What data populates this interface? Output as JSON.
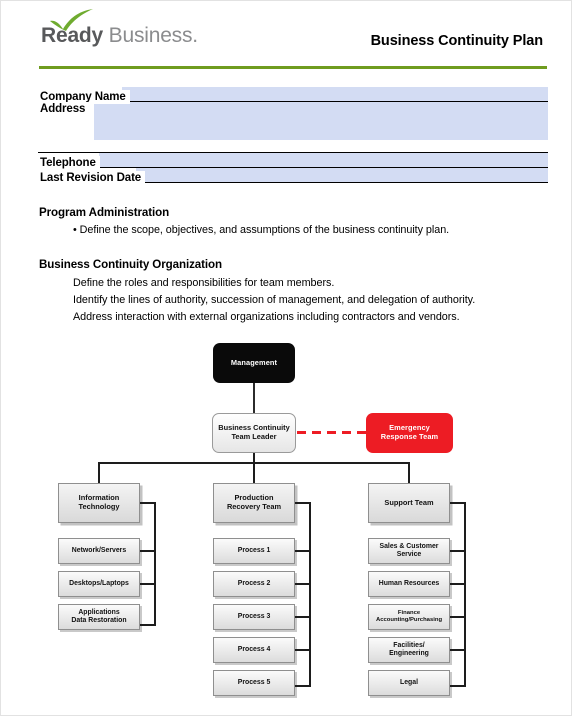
{
  "header": {
    "logo_ready": "Ready",
    "logo_business": " Business.",
    "check_icon": "green-check-icon",
    "doc_title": "Business Continuity Plan",
    "rule_color": "#6f9c1f"
  },
  "form": {
    "fields": [
      {
        "label": "Company Name",
        "value": "",
        "placeholder": ""
      },
      {
        "label": "Address",
        "value": "",
        "placeholder": ""
      },
      {
        "label": "Telephone",
        "value": "",
        "placeholder": ""
      },
      {
        "label": "Last Revision Date",
        "value": "",
        "placeholder": ""
      }
    ],
    "fill_color": "#d3dcf3"
  },
  "sections": [
    {
      "heading": "Program Administration",
      "lines": [
        "• Define the scope, objectives, and assumptions of the business continuity plan."
      ]
    },
    {
      "heading": "Business Continuity Organization",
      "lines": [
        "Define the roles and responsibilities for team members.",
        "Identify the lines of authority, succession of management, and delegation of authority.",
        "Address interaction with external organizations including contractors and vendors."
      ]
    }
  ],
  "org_chart": {
    "management": "Management",
    "team_leader_line1": "Business Continuity",
    "team_leader_line2": "Team Leader",
    "emergency_line1": "Emergency",
    "emergency_line2": "Response Team",
    "columns": [
      {
        "head_line1": "Information",
        "head_line2": "Technology",
        "children": [
          {
            "line1": "Network/Servers",
            "line2": ""
          },
          {
            "line1": "Desktops/Laptops",
            "line2": ""
          },
          {
            "line1": "Applications",
            "line2": "Data Restoration"
          }
        ]
      },
      {
        "head_line1": "Production",
        "head_line2": "Recovery Team",
        "children": [
          {
            "line1": "Process 1",
            "line2": ""
          },
          {
            "line1": "Process 2",
            "line2": ""
          },
          {
            "line1": "Process 3",
            "line2": ""
          },
          {
            "line1": "Process 4",
            "line2": ""
          },
          {
            "line1": "Process 5",
            "line2": ""
          }
        ]
      },
      {
        "head_line1": "Support Team",
        "head_line2": "",
        "children": [
          {
            "line1": "Sales & Customer",
            "line2": "Service"
          },
          {
            "line1": "Human Resources",
            "line2": ""
          },
          {
            "line1": "Finance",
            "line2": "Accounting/Purchasing"
          },
          {
            "line1": "Facilities/",
            "line2": "Engineering"
          },
          {
            "line1": "Legal",
            "line2": ""
          }
        ]
      }
    ],
    "colors": {
      "management_bg": "#0a0a0a",
      "emergency_bg": "#ed1c24",
      "connector": "#2b2b2b",
      "dashed_connector": "#ed1c24"
    }
  }
}
